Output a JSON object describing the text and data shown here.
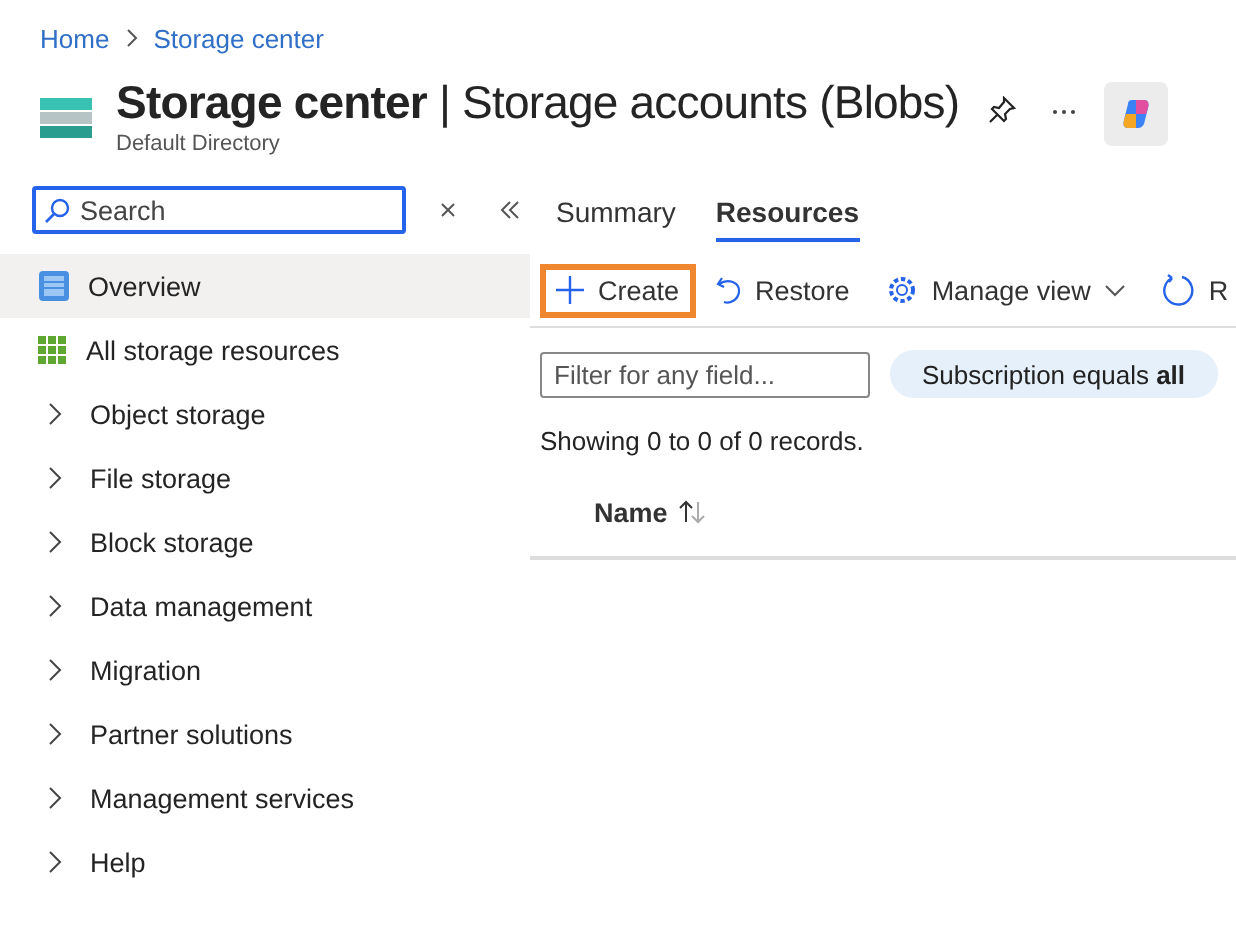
{
  "breadcrumb": [
    "Home",
    "Storage center"
  ],
  "header": {
    "title": "Storage center",
    "separator": "|",
    "subtitle_title": "Storage accounts (Blobs)",
    "directory": "Default Directory"
  },
  "sidebar": {
    "search": {
      "placeholder": "Search"
    },
    "items": [
      {
        "kind": "overview",
        "label": "Overview",
        "selected": true
      },
      {
        "kind": "all-resources",
        "label": "All storage resources",
        "selected": false
      },
      {
        "kind": "group",
        "label": "Object storage",
        "expanded": false,
        "selected": false
      },
      {
        "kind": "group",
        "label": "File storage",
        "expanded": false,
        "selected": false
      },
      {
        "kind": "group",
        "label": "Block storage",
        "expanded": false,
        "selected": false
      },
      {
        "kind": "group",
        "label": "Data management",
        "expanded": false,
        "selected": false
      },
      {
        "kind": "group",
        "label": "Migration",
        "expanded": false,
        "selected": false
      },
      {
        "kind": "group",
        "label": "Partner solutions",
        "expanded": false,
        "selected": false
      },
      {
        "kind": "group",
        "label": "Management services",
        "expanded": false,
        "selected": false
      },
      {
        "kind": "group",
        "label": "Help",
        "expanded": false,
        "selected": false
      }
    ]
  },
  "tabs": [
    {
      "label": "Summary",
      "selected": false
    },
    {
      "label": "Resources",
      "selected": true
    }
  ],
  "toolbar": [
    {
      "kind": "create",
      "label": "Create",
      "focused": true
    },
    {
      "kind": "restore",
      "label": "Restore",
      "focused": false
    },
    {
      "kind": "manage",
      "label": "Manage view",
      "focused": false
    },
    {
      "kind": "refresh",
      "label": "R",
      "focused": false
    }
  ],
  "filter": {
    "placeholder": "Filter for any field..."
  },
  "filter_pill": "Subscription equals **all**",
  "records": "Showing 0 to 0 of 0 records.",
  "table": {
    "columns": [
      {
        "label": "Name",
        "sortable": true
      }
    ]
  }
}
